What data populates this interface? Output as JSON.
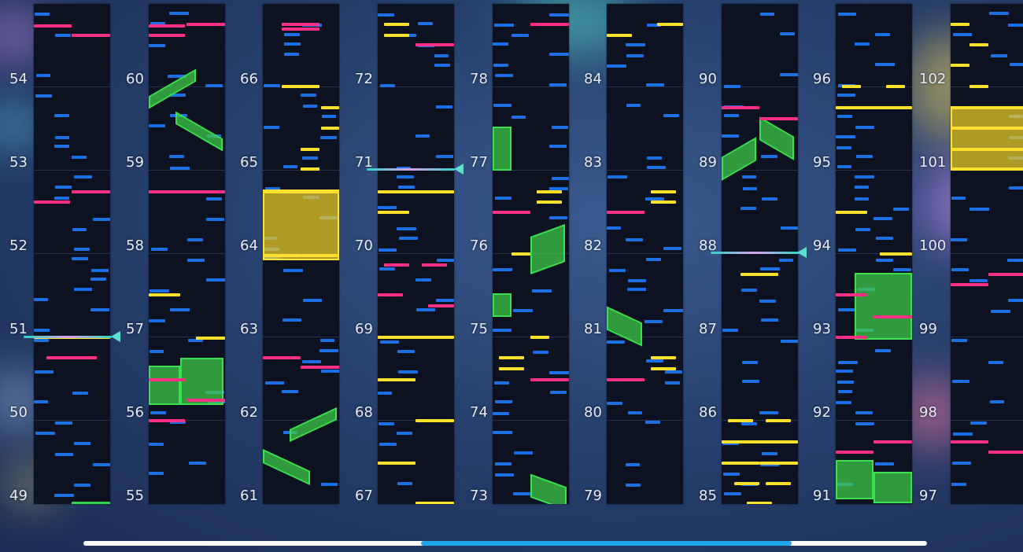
{
  "view": {
    "description_free": true,
    "scroll": {
      "thumb_start": 0.4,
      "thumb_end": 0.84
    }
  },
  "colors": {
    "tap": "#1d6fe6",
    "flick": "#ff2f86",
    "hold": "#ffe02a",
    "slide": "#2ed64b",
    "column_bg": "#0c1220",
    "label": "#e6ecf7"
  },
  "columns": [
    {
      "labels": [
        "54",
        "53",
        "52",
        "51",
        "50",
        "49"
      ]
    },
    {
      "labels": [
        "60",
        "59",
        "58",
        "57",
        "56",
        "55"
      ]
    },
    {
      "labels": [
        "66",
        "65",
        "64",
        "63",
        "62",
        "61"
      ]
    },
    {
      "labels": [
        "72",
        "71",
        "70",
        "69",
        "68",
        "67"
      ]
    },
    {
      "labels": [
        "78",
        "77",
        "76",
        "75",
        "74",
        "73"
      ]
    },
    {
      "labels": [
        "84",
        "83",
        "82",
        "81",
        "80",
        "79"
      ]
    },
    {
      "labels": [
        "90",
        "89",
        "88",
        "87",
        "86",
        "85"
      ]
    },
    {
      "labels": [
        "96",
        "95",
        "94",
        "93",
        "92",
        "91"
      ]
    },
    {
      "labels": [
        "102",
        "101",
        "100",
        "99",
        "98",
        "97"
      ]
    }
  ]
}
